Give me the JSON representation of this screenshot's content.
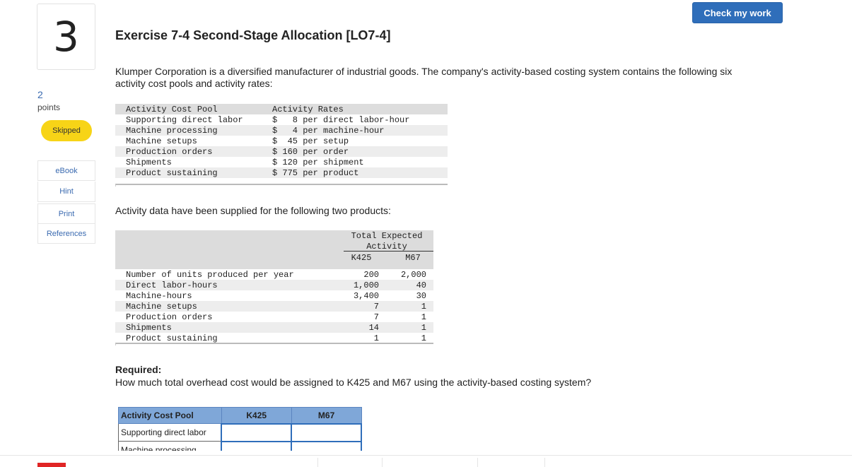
{
  "header": {
    "check_label": "Check my work"
  },
  "question": {
    "number": "3",
    "points_value": "2",
    "points_label": "points",
    "status": "Skipped"
  },
  "sidebar": {
    "items": [
      {
        "label": "eBook"
      },
      {
        "label": "Hint"
      },
      {
        "label": "Print"
      },
      {
        "label": "References"
      }
    ]
  },
  "exercise": {
    "title": "Exercise 7-4 Second-Stage Allocation [LO7-4]",
    "intro": "Klumper Corporation is a diversified manufacturer of industrial goods. The company's activity-based costing system contains the following six activity cost pools and activity rates:"
  },
  "rates_table": {
    "headers": [
      "Activity Cost Pool",
      "Activity Rates"
    ],
    "rows": [
      {
        "pool": "Supporting direct labor",
        "rate": "$   8 per direct labor-hour"
      },
      {
        "pool": "Machine processing",
        "rate": "$   4 per machine-hour"
      },
      {
        "pool": "Machine setups",
        "rate": "$  45 per setup"
      },
      {
        "pool": "Production orders",
        "rate": "$ 160 per order"
      },
      {
        "pool": "Shipments",
        "rate": "$ 120 per shipment"
      },
      {
        "pool": "Product sustaining",
        "rate": "$ 775 per product"
      }
    ]
  },
  "activity_intro": "Activity data have been supplied for the following two products:",
  "activity_table": {
    "group_header": [
      "Total Expected",
      "Activity"
    ],
    "col_k": "K425",
    "col_m": "M67",
    "rows": [
      {
        "label": "Number of units produced per year",
        "k": "200",
        "m": "2,000"
      },
      {
        "label": "Direct labor-hours",
        "k": "1,000",
        "m": "40"
      },
      {
        "label": "Machine-hours",
        "k": "3,400",
        "m": "30"
      },
      {
        "label": "Machine setups",
        "k": "7",
        "m": "1"
      },
      {
        "label": "Production orders",
        "k": "7",
        "m": "1"
      },
      {
        "label": "Shipments",
        "k": "14",
        "m": "1"
      },
      {
        "label": "Product sustaining",
        "k": "1",
        "m": "1"
      }
    ]
  },
  "required": {
    "heading": "Required:",
    "text": "How much total overhead cost would be assigned to K425 and M67 using the activity-based costing system?"
  },
  "answer_table": {
    "headers": [
      "Activity Cost Pool",
      "K425",
      "M67"
    ],
    "rows": [
      {
        "label": "Supporting direct labor",
        "k": "",
        "m": ""
      },
      {
        "label": "Machine processing",
        "k": "",
        "m": ""
      }
    ]
  },
  "colors": {
    "accent": "#2f6eba",
    "skipped": "#f7d417",
    "answer_header": "#7fa7d8"
  }
}
